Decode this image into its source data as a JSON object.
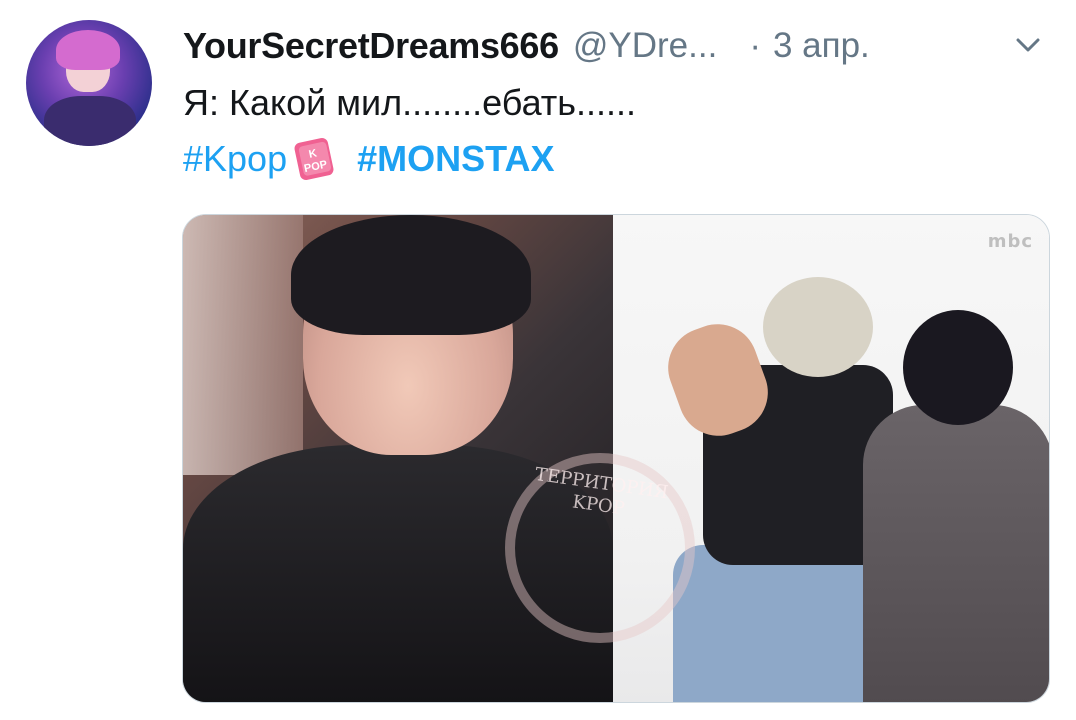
{
  "tweet": {
    "display_name": "YourSecretDreams666",
    "handle": "@YDre...",
    "separator": "·",
    "date": "3 апр.",
    "text": "Я: Какой мил........ебать......",
    "hashtags": [
      {
        "label": "#Kpop"
      },
      {
        "label": "#MONSTAX"
      }
    ],
    "emoji_text": "K POP"
  },
  "media": {
    "watermark_text": "ТЕРРИТОРИЯ KPOP",
    "broadcast_logo": "mbc"
  },
  "colors": {
    "link": "#1da1f2",
    "text": "#14171a",
    "secondary": "#657786",
    "border": "#ccd6dd"
  }
}
